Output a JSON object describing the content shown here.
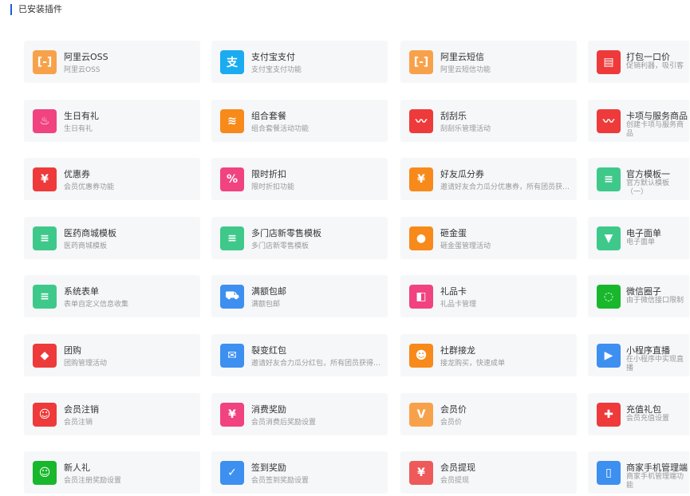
{
  "header": {
    "title": "已安装插件"
  },
  "plugins": [
    {
      "title": "阿里云OSS",
      "desc": "阿里云OSS",
      "color": "#f7a24a",
      "icon": "aliyun-icon",
      "glyph": "[-]"
    },
    {
      "title": "支付宝支付",
      "desc": "支付宝支付功能",
      "color": "#1aabf0",
      "icon": "alipay-icon",
      "glyph": "支"
    },
    {
      "title": "阿里云短信",
      "desc": "阿里云短信功能",
      "color": "#f7a24a",
      "icon": "aliyun-icon",
      "glyph": "[-]"
    },
    {
      "title": "打包一口价",
      "desc": "促销利器，吸引客",
      "color": "#ee3a3a",
      "icon": "package-box-icon",
      "glyph": "▤"
    },
    {
      "title": "生日有礼",
      "desc": "生日有礼",
      "color": "#f0437f",
      "icon": "birthday-cake-icon",
      "glyph": "♨"
    },
    {
      "title": "组合套餐",
      "desc": "组合套餐活动功能",
      "color": "#f78a1b",
      "icon": "layers-icon",
      "glyph": "≋"
    },
    {
      "title": "刮刮乐",
      "desc": "刮刮乐管理活动",
      "color": "#ee3a3a",
      "icon": "scratch-card-icon",
      "glyph": "〰"
    },
    {
      "title": "卡项与服务商品",
      "desc": "创建卡项与服务商品",
      "color": "#ee3a3a",
      "icon": "scratch-card-icon",
      "glyph": "〰"
    },
    {
      "title": "优惠券",
      "desc": "会员优惠券功能",
      "color": "#ee3a3a",
      "icon": "coupon-icon",
      "glyph": "¥"
    },
    {
      "title": "限时折扣",
      "desc": "限时折扣功能",
      "color": "#f0437f",
      "icon": "discount-icon",
      "glyph": "%"
    },
    {
      "title": "好友瓜分券",
      "desc": "邀请好友合力瓜分优惠券，所有团员获得奖励",
      "color": "#f78a1b",
      "icon": "red-envelope-icon",
      "glyph": "¥"
    },
    {
      "title": "官方模板一",
      "desc": "官方默认模板（一）",
      "color": "#3ec98a",
      "icon": "document-icon",
      "glyph": "≡"
    },
    {
      "title": "医药商城模板",
      "desc": "医药商城模板",
      "color": "#3ec98a",
      "icon": "document-icon",
      "glyph": "≡"
    },
    {
      "title": "多门店新零售模板",
      "desc": "多门店新零售模板",
      "color": "#3ec98a",
      "icon": "document-icon",
      "glyph": "≡"
    },
    {
      "title": "砸金蛋",
      "desc": "砸金蛋管理活动",
      "color": "#f78a1b",
      "icon": "golden-egg-icon",
      "glyph": "●"
    },
    {
      "title": "电子面单",
      "desc": "电子面单",
      "color": "#3ec98a",
      "icon": "bookmark-icon",
      "glyph": "▼"
    },
    {
      "title": "系统表单",
      "desc": "表单自定义信息收集",
      "color": "#3ec98a",
      "icon": "document-icon",
      "glyph": "≡"
    },
    {
      "title": "满额包邮",
      "desc": "满额包邮",
      "color": "#3d8ff0",
      "icon": "truck-icon",
      "glyph": "⛟"
    },
    {
      "title": "礼品卡",
      "desc": "礼品卡管理",
      "color": "#f0437f",
      "icon": "gift-card-icon",
      "glyph": "◧"
    },
    {
      "title": "微信圈子",
      "desc": "由于微信接口限制",
      "color": "#18b72c",
      "icon": "wechat-circle-icon",
      "glyph": "◌"
    },
    {
      "title": "团购",
      "desc": "团购管理活动",
      "color": "#ee3a3a",
      "icon": "tag-icon",
      "glyph": "◆"
    },
    {
      "title": "裂变红包",
      "desc": "邀请好友合力瓜分红包，所有团员获得奖励",
      "color": "#3d8ff0",
      "icon": "envelope-icon",
      "glyph": "✉"
    },
    {
      "title": "社群接龙",
      "desc": "接龙购买，快速成单",
      "color": "#f78a1b",
      "icon": "group-icon",
      "glyph": "☻"
    },
    {
      "title": "小程序直播",
      "desc": "在小程序中实现直播",
      "color": "#3d8ff0",
      "icon": "tv-play-icon",
      "glyph": "▶"
    },
    {
      "title": "会员注销",
      "desc": "会员注销",
      "color": "#ee3a3a",
      "icon": "user-remove-icon",
      "glyph": "☺"
    },
    {
      "title": "消费奖励",
      "desc": "会员消费后奖励设置",
      "color": "#f0437f",
      "icon": "money-bag-icon",
      "glyph": "¥"
    },
    {
      "title": "会员价",
      "desc": "会员价",
      "color": "#f7a24a",
      "icon": "shopping-bag-icon",
      "glyph": "V"
    },
    {
      "title": "充值礼包",
      "desc": "会员充值设置",
      "color": "#ee3a3a",
      "icon": "gift-icon",
      "glyph": "✚"
    },
    {
      "title": "新人礼",
      "desc": "会员注册奖励设置",
      "color": "#18b72c",
      "icon": "user-add-icon",
      "glyph": "☺"
    },
    {
      "title": "签到奖励",
      "desc": "会员签到奖励设置",
      "color": "#3d8ff0",
      "icon": "calendar-check-icon",
      "glyph": "✓"
    },
    {
      "title": "会员提现",
      "desc": "会员提现",
      "color": "#ee5a5a",
      "icon": "withdraw-icon",
      "glyph": "¥"
    },
    {
      "title": "商家手机管理端",
      "desc": "商家手机管理端功能",
      "color": "#3d8ff0",
      "icon": "mobile-phone-icon",
      "glyph": "▯"
    }
  ]
}
